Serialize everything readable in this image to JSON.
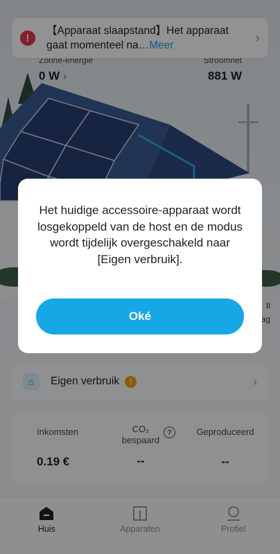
{
  "banner": {
    "text": "【Apparaat slaapstand】Het apparaat gaat momenteel na…",
    "more": "Meer"
  },
  "stats": {
    "solar_label": "Zonne-energie",
    "solar_value": "0 W",
    "grid_label": "Stroomnet",
    "grid_value": "881 W"
  },
  "side_labels": [
    "ti",
    "ag"
  ],
  "mode": {
    "label": "Eigen verbruik"
  },
  "summary": {
    "income_label": "Inkomsten",
    "income_value": "0.19 €",
    "co2_label_line1": "CO₂",
    "co2_label_line2": "bespaard",
    "co2_value": "--",
    "produced_label": "Geproduceerd",
    "produced_value": "--"
  },
  "tabs": [
    {
      "label": "Huis"
    },
    {
      "label": "Apparaten"
    },
    {
      "label": "Profiel"
    }
  ],
  "dialog": {
    "message": "Het huidige accessoire-apparaat wordt losgekoppeld van de host en de modus wordt tijdelijk overgeschakeld naar [Eigen verbruik].",
    "ok_label": "Oké"
  },
  "colors": {
    "accent": "#16a8e6",
    "alert": "#e0384d",
    "warning": "#f0a000",
    "link": "#1a9de0"
  }
}
